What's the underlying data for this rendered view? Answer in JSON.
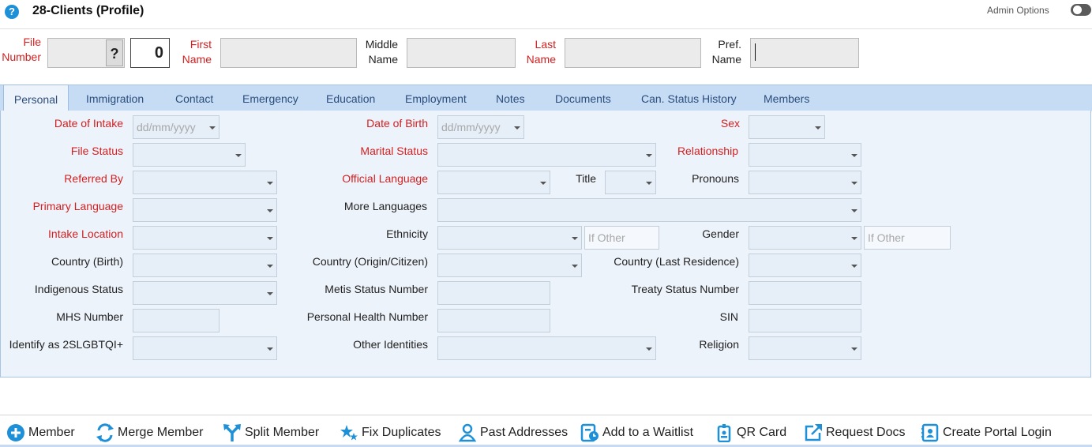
{
  "header": {
    "title": "28-Clients (Profile)",
    "admin_label": "Admin Options"
  },
  "name_row": {
    "file_label_1": "File",
    "file_label_2": "Number",
    "file_q": "?",
    "file_count": "0",
    "first_label_1": "First",
    "first_label_2": "Name",
    "middle_label_1": "Middle",
    "middle_label_2": "Name",
    "last_label_1": "Last",
    "last_label_2": "Name",
    "pref_label_1": "Pref.",
    "pref_label_2": "Name"
  },
  "tabs": [
    {
      "label": "Personal"
    },
    {
      "label": "Immigration"
    },
    {
      "label": "Contact"
    },
    {
      "label": "Emergency"
    },
    {
      "label": "Education"
    },
    {
      "label": "Employment"
    },
    {
      "label": "Notes"
    },
    {
      "label": "Documents"
    },
    {
      "label": "Can. Status History"
    },
    {
      "label": "Members"
    }
  ],
  "form": {
    "date_of_intake": "Date of Intake",
    "date_of_birth": "Date of Birth",
    "sex": "Sex",
    "date_placeholder": "dd/mm/yyyy",
    "file_status": "File Status",
    "marital_status": "Marital Status",
    "relationship": "Relationship",
    "referred_by": "Referred By",
    "official_language": "Official Language",
    "title": "Title",
    "pronouns": "Pronouns",
    "primary_language": "Primary Language",
    "more_languages": "More Languages",
    "intake_location": "Intake Location",
    "ethnicity": "Ethnicity",
    "gender": "Gender",
    "if_other": "If Other",
    "country_birth": "Country (Birth)",
    "country_origin": "Country (Origin/Citizen)",
    "country_last": "Country (Last Residence)",
    "indigenous_status": "Indigenous Status",
    "metis_status": "Metis Status Number",
    "treaty_status": "Treaty Status Number",
    "mhs_number": "MHS Number",
    "personal_health": "Personal Health Number",
    "sin": "SIN",
    "identify_2slgbtqi": "Identify as 2SLGBTQI+",
    "other_identities": "Other Identities",
    "religion": "Religion"
  },
  "toolbar": {
    "member": "Member",
    "merge_member": "Merge Member",
    "split_member": "Split Member",
    "fix_duplicates": "Fix Duplicates",
    "past_addresses": "Past Addresses",
    "add_waitlist": "Add to a Waitlist",
    "qr_card": "QR Card",
    "request_docs": "Request Docs",
    "create_portal_login": "Create Portal Login"
  },
  "colors": {
    "required_label": "#d22020",
    "tab_bar": "#c6dcf4",
    "panel": "#edf3fb",
    "icon_blue": "#1e90d8"
  }
}
